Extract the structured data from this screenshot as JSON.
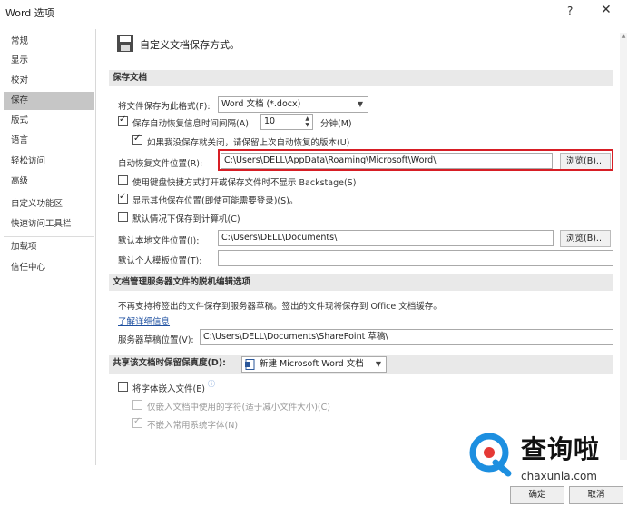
{
  "window": {
    "title": "Word 选项",
    "help": "?",
    "close": "✕"
  },
  "sidebar": {
    "items": [
      {
        "label": "常规"
      },
      {
        "label": "显示"
      },
      {
        "label": "校对"
      },
      {
        "label": "保存",
        "active": true
      },
      {
        "label": "版式"
      },
      {
        "label": "语言"
      },
      {
        "label": "轻松访问"
      },
      {
        "label": "高级"
      },
      {
        "label": "自定义功能区"
      },
      {
        "label": "快速访问工具栏"
      },
      {
        "label": "加载项"
      },
      {
        "label": "信任中心"
      }
    ]
  },
  "header": {
    "title": "自定义文档保存方式。"
  },
  "sections": {
    "save_docs": "保存文档",
    "offline": "文档管理服务器文件的脱机编辑选项",
    "fidelity": "共享该文档时保留保真度(D):"
  },
  "save": {
    "format_label": "将文件保存为此格式(F):",
    "format_value": "Word 文档 (*.docx)",
    "autorecover_label": "保存自动恢复信息时间间隔(A)",
    "autorecover_minutes": "10",
    "minutes_label": "分钟(M)",
    "keep_last_label": "如果我没保存就关闭，请保留上次自动恢复的版本(U)",
    "autorecover_location_label": "自动恢复文件位置(R):",
    "autorecover_location_value": "C:\\Users\\DELL\\AppData\\Roaming\\Microsoft\\Word\\",
    "browse_label": "浏览(B)...",
    "backstage_label": "使用键盘快捷方式打开或保存文件时不显示 Backstage(S)",
    "show_more_label": "显示其他保存位置(即使可能需要登录)(S)。",
    "save_to_computer_label": "默认情况下保存到计算机(C)",
    "default_local_label": "默认本地文件位置(I):",
    "default_local_value": "C:\\Users\\DELL\\Documents\\",
    "default_template_label": "默认个人模板位置(T):",
    "default_template_value": ""
  },
  "offline": {
    "note": "不再支持将签出的文件保存到服务器草稿。签出的文件现将保存到 Office 文档缓存。",
    "learn_more": "了解详细信息",
    "drafts_label": "服务器草稿位置(V):",
    "drafts_value": "C:\\Users\\DELL\\Documents\\SharePoint 草稿\\"
  },
  "fidelity": {
    "doc_value": "新建 Microsoft Word 文档",
    "embed_fonts_label": "将字体嵌入文件(E)",
    "embed_subset_label": "仅嵌入文档中使用的字符(适于减小文件大小)(C)",
    "no_common_label": "不嵌入常用系统字体(N)"
  },
  "buttons": {
    "ok": "确定",
    "cancel": "取消"
  },
  "watermark": {
    "logo_text": "查询啦",
    "url": "chaxunla.com"
  },
  "colors": {
    "highlight_box": "#d71e25",
    "section_bg": "#e9e9e9",
    "link": "#1d4fa0"
  }
}
